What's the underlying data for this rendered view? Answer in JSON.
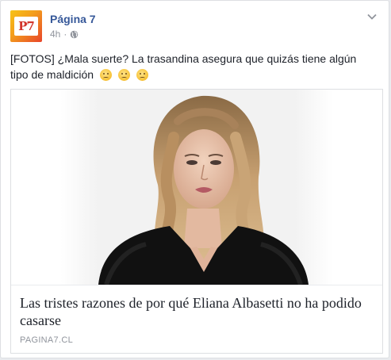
{
  "post": {
    "page_name": "Página 7",
    "avatar_text": "P7",
    "time": "4h",
    "separator": "·",
    "privacy_icon": "globe-icon",
    "menu_icon": "chevron-down-icon",
    "text": "[FOTOS] ¿Mala suerte? La trasandina asegura que quizás tiene algún tipo de maldición",
    "emoji_count": 3
  },
  "link": {
    "title": "Las tristes razones de por qué Eliana Albasetti no ha podido casarse",
    "domain": "PAGINA7.CL"
  },
  "colors": {
    "page_name": "#365899",
    "meta": "#90949c",
    "text": "#1d2129",
    "border": "#dddfe2"
  }
}
